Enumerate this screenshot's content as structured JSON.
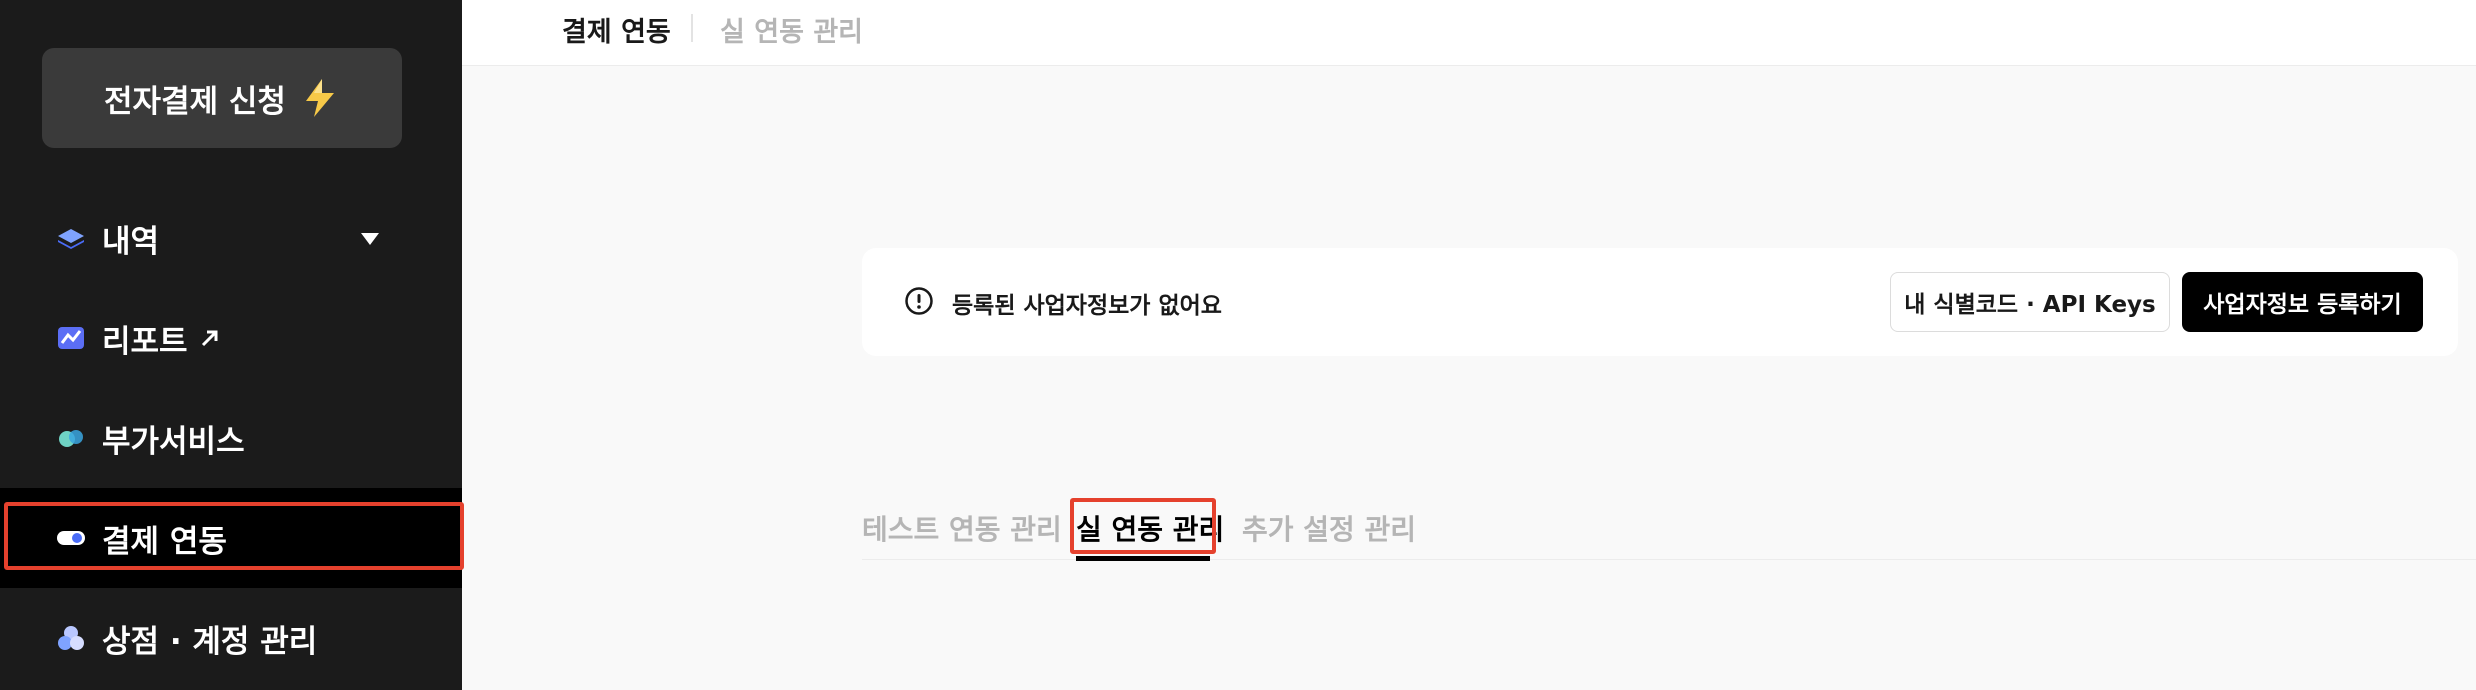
{
  "sidebar": {
    "cta_label": "전자결제 신청",
    "cta_icon": "lightning-icon",
    "items": [
      {
        "label": "내역",
        "icon": "layers-icon"
      },
      {
        "label": "리포트",
        "icon": "chart-icon"
      },
      {
        "label": "부가서비스",
        "icon": "pills-icon"
      },
      {
        "label": "결제 연동",
        "icon": "toggle-icon"
      },
      {
        "label": "상점 · 계정 관리",
        "icon": "store-icon"
      }
    ]
  },
  "topbar": {
    "primary": "결제 연동",
    "secondary": "실 연동 관리"
  },
  "alert": {
    "message": "등록된 사업자정보가 없어요",
    "api_keys_button": "내 식별코드 · API Keys",
    "register_button": "사업자정보 등록하기"
  },
  "tabs": [
    {
      "label": "테스트 연동 관리"
    },
    {
      "label": "실 연동 관리"
    },
    {
      "label": "추가 설정 관리"
    }
  ],
  "colors": {
    "sidebar_bg": "#1b1b1b",
    "highlight": "#e5412d",
    "accent_blue": "#4a6cf7"
  }
}
